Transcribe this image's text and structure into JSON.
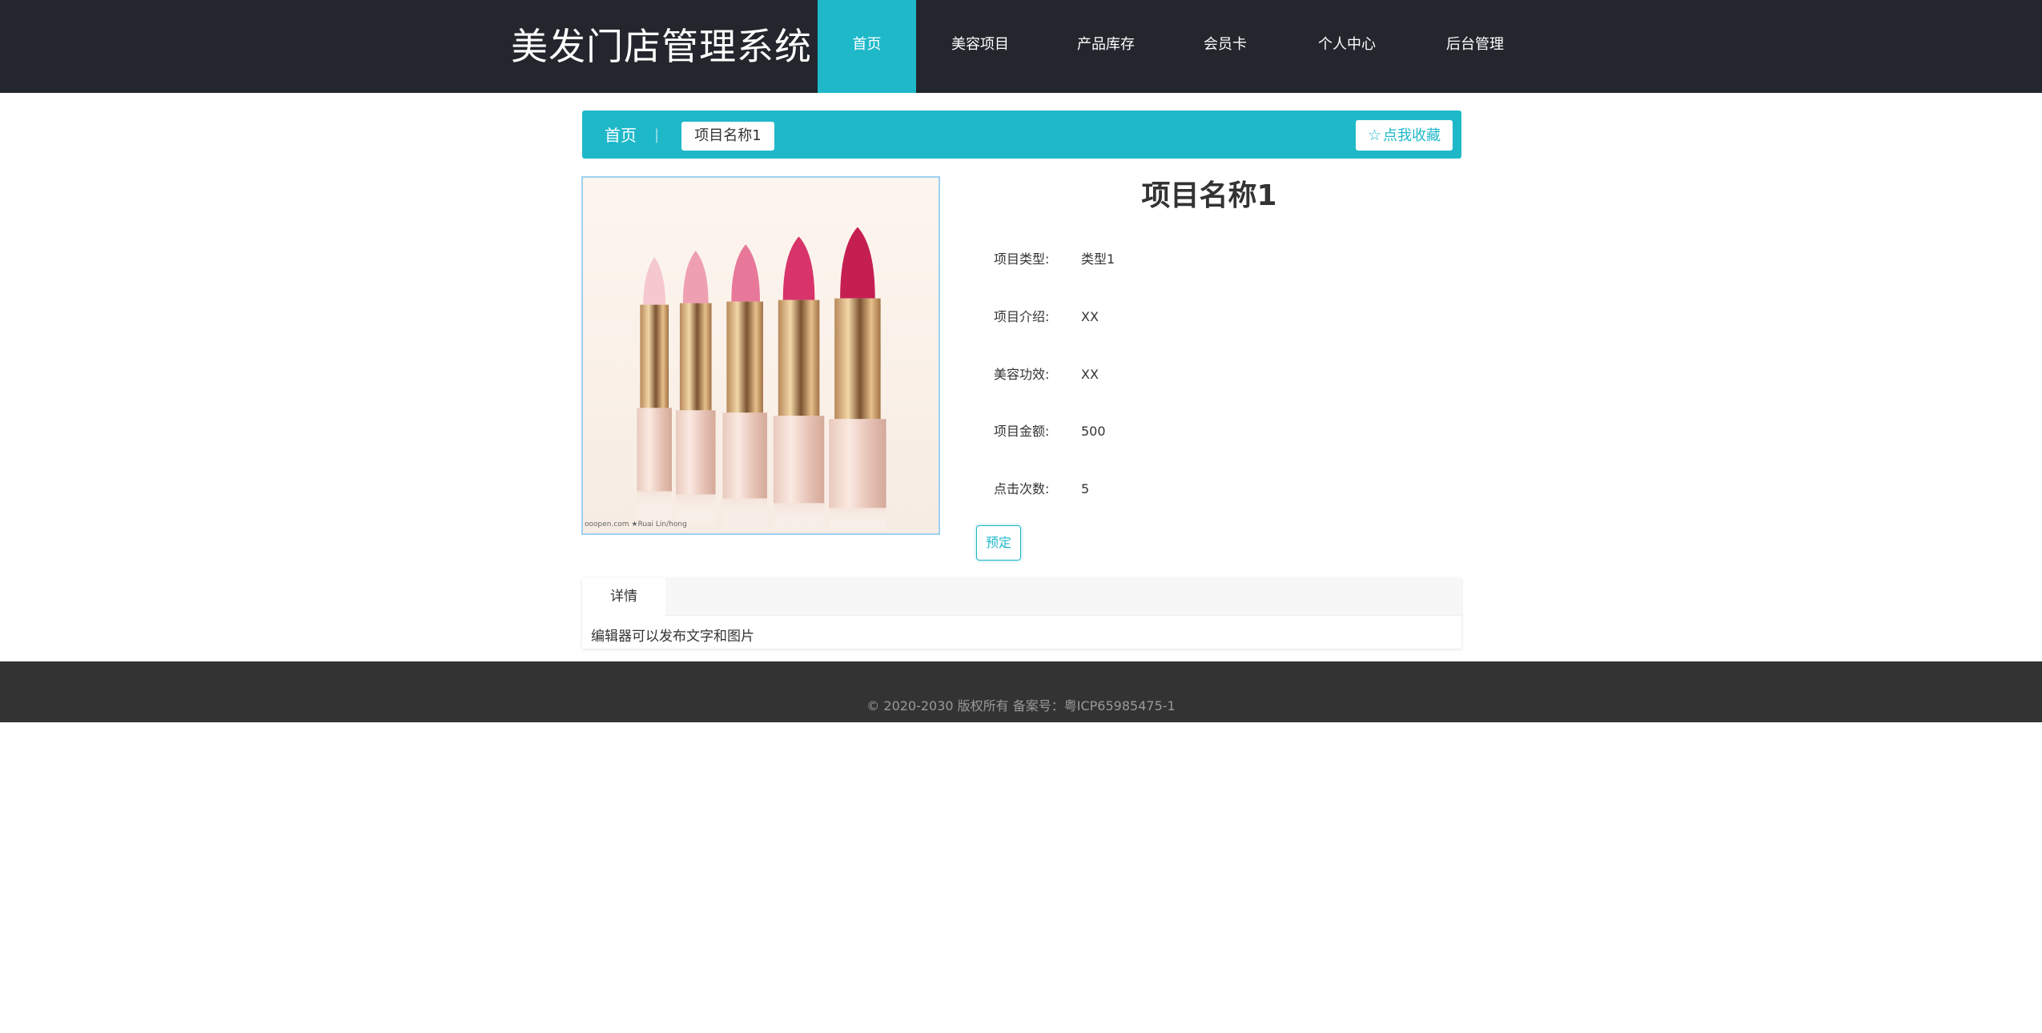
{
  "header": {
    "brand": "美发门店管理系统",
    "nav": [
      {
        "label": "首页",
        "active": true
      },
      {
        "label": "美容项目"
      },
      {
        "label": "产品库存"
      },
      {
        "label": "会员卡"
      },
      {
        "label": "个人中心"
      },
      {
        "label": "后台管理"
      }
    ]
  },
  "breadcrumb": {
    "home": "首页",
    "separator": "|",
    "current": "项目名称1",
    "favorite_label": "点我收藏",
    "favorite_icon": "star-outline-icon"
  },
  "product": {
    "title": "项目名称1",
    "image_watermark": "ooopen.com ★Ruai Lin/hong",
    "fields": [
      {
        "label": "项目类型:",
        "value": "类型1"
      },
      {
        "label": "项目介绍:",
        "value": "XX"
      },
      {
        "label": "美容功效:",
        "value": "XX"
      },
      {
        "label": "项目金额:",
        "value": "500"
      },
      {
        "label": "点击次数:",
        "value": "5"
      }
    ],
    "book_label": "预定"
  },
  "tabs": {
    "active_label": "详情",
    "content": "编辑器可以发布文字和图片"
  },
  "footer": {
    "text": "© 2020-2030 版权所有 备案号：粤ICP65985475-1"
  },
  "colors": {
    "header_bg": "#23262d",
    "accent": "#1fb8c9",
    "footer_bg": "#333333"
  }
}
